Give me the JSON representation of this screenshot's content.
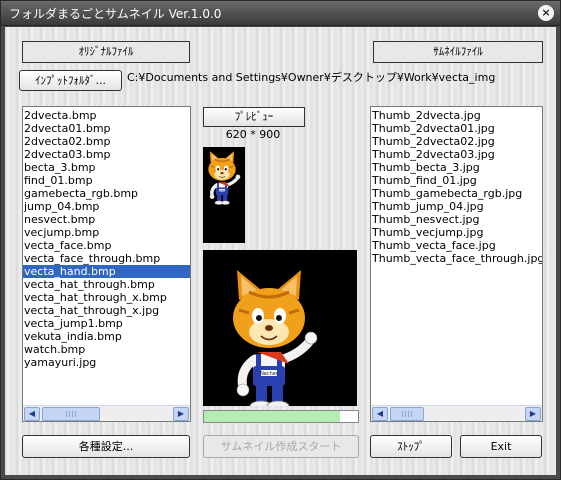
{
  "window": {
    "title": "フォルダまるごとサムネイル Ver.1.0.0",
    "close_label": "×"
  },
  "headers": {
    "original": "ｵﾘｼﾞﾅﾙﾌｧｲﾙ",
    "thumbnail": "ｻﾑﾈｲﾙﾌｧｲﾙ"
  },
  "input": {
    "button_label": "ｲﾝﾌﾟｯﾄﾌｫﾙﾀﾞ...",
    "path": "C:¥Documents and Settings¥Owner¥デスクトップ¥Work¥vecta_img"
  },
  "preview": {
    "button_label": "ﾌﾟﾚﾋﾞｭｰ",
    "dimensions": "620 * 900",
    "progress": 0.88
  },
  "source_files": [
    "2dvecta.bmp",
    "2dvecta01.bmp",
    "2dvecta02.bmp",
    "2dvecta03.bmp",
    "becta_3.bmp",
    "find_01.bmp",
    "gamebecta_rgb.bmp",
    "jump_04.bmp",
    "nesvect.bmp",
    "vecjump.bmp",
    "vecta_face.bmp",
    "vecta_face_through.bmp",
    "vecta_hand.bmp",
    "vecta_hat_through.bmp",
    "vecta_hat_through_x.bmp",
    "vecta_hat_through_x.jpg",
    "vecta_jump1.bmp",
    "vekuta_india.bmp",
    "watch.bmp",
    "yamayuri.jpg"
  ],
  "selected_index": 12,
  "thumb_files": [
    "Thumb_2dvecta.jpg",
    "Thumb_2dvecta01.jpg",
    "Thumb_2dvecta02.jpg",
    "Thumb_2dvecta03.jpg",
    "Thumb_becta_3.jpg",
    "Thumb_find_01.jpg",
    "Thumb_gamebecta_rgb.jpg",
    "Thumb_jump_04.jpg",
    "Thumb_nesvect.jpg",
    "Thumb_vecjump.jpg",
    "Thumb_vecta_face.jpg",
    "Thumb_vecta_face_through.jpg"
  ],
  "buttons": {
    "settings": "各種設定...",
    "start": "サムネイル作成スタート",
    "stop": "ｽﾄｯﾌﾟ",
    "exit": "Exit"
  },
  "scroll_arrows": {
    "left": "◀",
    "right": "▶"
  },
  "colors": {
    "selection": "#3167c4",
    "progress_fill": "#b5ecb4",
    "scrollbar": "#c5d5f4"
  }
}
